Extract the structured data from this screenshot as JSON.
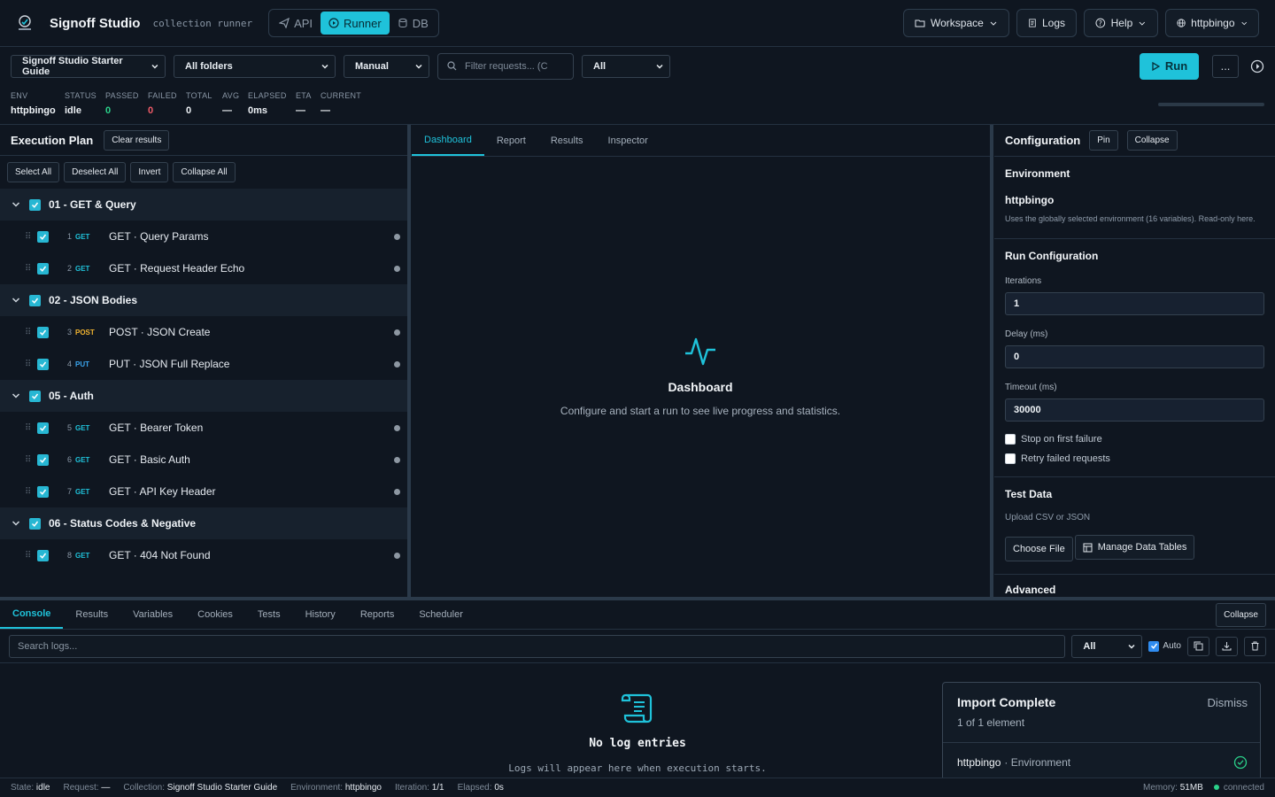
{
  "app": {
    "title": "Signoff Studio",
    "subtitle": "collection runner",
    "logo_text": "Signoff"
  },
  "modes": [
    {
      "label": "API"
    },
    {
      "label": "Runner"
    },
    {
      "label": "DB"
    }
  ],
  "topbar": {
    "workspace": "Workspace",
    "logs": "Logs",
    "help": "Help",
    "env": "httpbingo"
  },
  "filters": {
    "collection": "Signoff Studio Starter Guide",
    "folders": "All folders",
    "mode": "Manual",
    "search_placeholder": "Filter requests... (C",
    "method": "All",
    "run_label": "Run",
    "more_label": "..."
  },
  "stats": [
    {
      "label": "ENV",
      "value": "httpbingo"
    },
    {
      "label": "STATUS",
      "value": "idle"
    },
    {
      "label": "PASSED",
      "value": "0"
    },
    {
      "label": "FAILED",
      "value": "0"
    },
    {
      "label": "TOTAL",
      "value": "0"
    },
    {
      "label": "AVG",
      "value": "—"
    },
    {
      "label": "ELAPSED",
      "value": "0ms"
    },
    {
      "label": "ETA",
      "value": "—"
    },
    {
      "label": "CURRENT",
      "value": "—"
    }
  ],
  "progress_fraction": 0,
  "plan": {
    "title": "Execution Plan",
    "clear_label": "Clear results",
    "actions": [
      "Select All",
      "Deselect All",
      "Invert",
      "Collapse All"
    ],
    "folders": [
      {
        "name": "01 - GET & Query",
        "requests": [
          {
            "num": "1",
            "method": "GET",
            "name": "GET · Query Params"
          },
          {
            "num": "2",
            "method": "GET",
            "name": "GET · Request Header Echo"
          }
        ]
      },
      {
        "name": "02 - JSON Bodies",
        "requests": [
          {
            "num": "3",
            "method": "POST",
            "name": "POST · JSON Create"
          },
          {
            "num": "4",
            "method": "PUT",
            "name": "PUT · JSON Full Replace"
          }
        ]
      },
      {
        "name": "05 - Auth",
        "requests": [
          {
            "num": "5",
            "method": "GET",
            "name": "GET · Bearer Token"
          },
          {
            "num": "6",
            "method": "GET",
            "name": "GET · Basic Auth"
          },
          {
            "num": "7",
            "method": "GET",
            "name": "GET · API Key Header"
          }
        ]
      },
      {
        "name": "06 - Status Codes & Negative",
        "requests": [
          {
            "num": "8",
            "method": "GET",
            "name": "GET · 404 Not Found"
          }
        ]
      }
    ]
  },
  "center": {
    "tabs": [
      "Dashboard",
      "Report",
      "Results",
      "Inspector"
    ],
    "empty_title": "Dashboard",
    "empty_text": "Configure and start a run to see live progress and statistics."
  },
  "config": {
    "title": "Configuration",
    "pin": "Pin",
    "collapse": "Collapse",
    "env_section": "Environment",
    "env_name": "httpbingo",
    "env_hint": "Uses the globally selected environment (16 variables). Read-only here.",
    "run_section": "Run Configuration",
    "iterations_label": "Iterations",
    "iterations": "1",
    "delay_label": "Delay (ms)",
    "delay": "0",
    "timeout_label": "Timeout (ms)",
    "timeout": "30000",
    "stop_label": "Stop on first failure",
    "retry_label": "Retry failed requests",
    "data_section": "Test Data",
    "data_hint": "Upload CSV or JSON",
    "choose_file": "Choose File",
    "manage_tables": "Manage Data Tables",
    "advanced": "Advanced"
  },
  "bottom": {
    "tabs": [
      "Console",
      "Results",
      "Variables",
      "Cookies",
      "Tests",
      "History",
      "Reports",
      "Scheduler"
    ],
    "collapse": "Collapse",
    "search_placeholder": "Search logs...",
    "level": "All",
    "auto_label": "Auto",
    "empty_title": "No log entries",
    "empty_text": "Logs will appear here when execution starts."
  },
  "toast": {
    "title": "Import Complete",
    "subtitle": "1 of 1 element",
    "dismiss": "Dismiss",
    "item_name": "httpbingo",
    "item_kind": "· Environment"
  },
  "statusbar": {
    "items": [
      {
        "label": "State:",
        "value": "idle"
      },
      {
        "label": "Request:",
        "value": "—"
      },
      {
        "label": "Collection:",
        "value": "Signoff Studio Starter Guide"
      },
      {
        "label": "Environment:",
        "value": "httpbingo"
      },
      {
        "label": "Iteration:",
        "value": "1/1"
      },
      {
        "label": "Elapsed:",
        "value": "0s"
      }
    ],
    "memory_label": "Memory:",
    "memory": "51MB",
    "connection": "connected"
  },
  "colors": {
    "accent": "#1fc2da",
    "passed": "#2bd18a",
    "failed": "#ef5b68",
    "post": "#f1b431",
    "put": "#3aa5ee"
  }
}
